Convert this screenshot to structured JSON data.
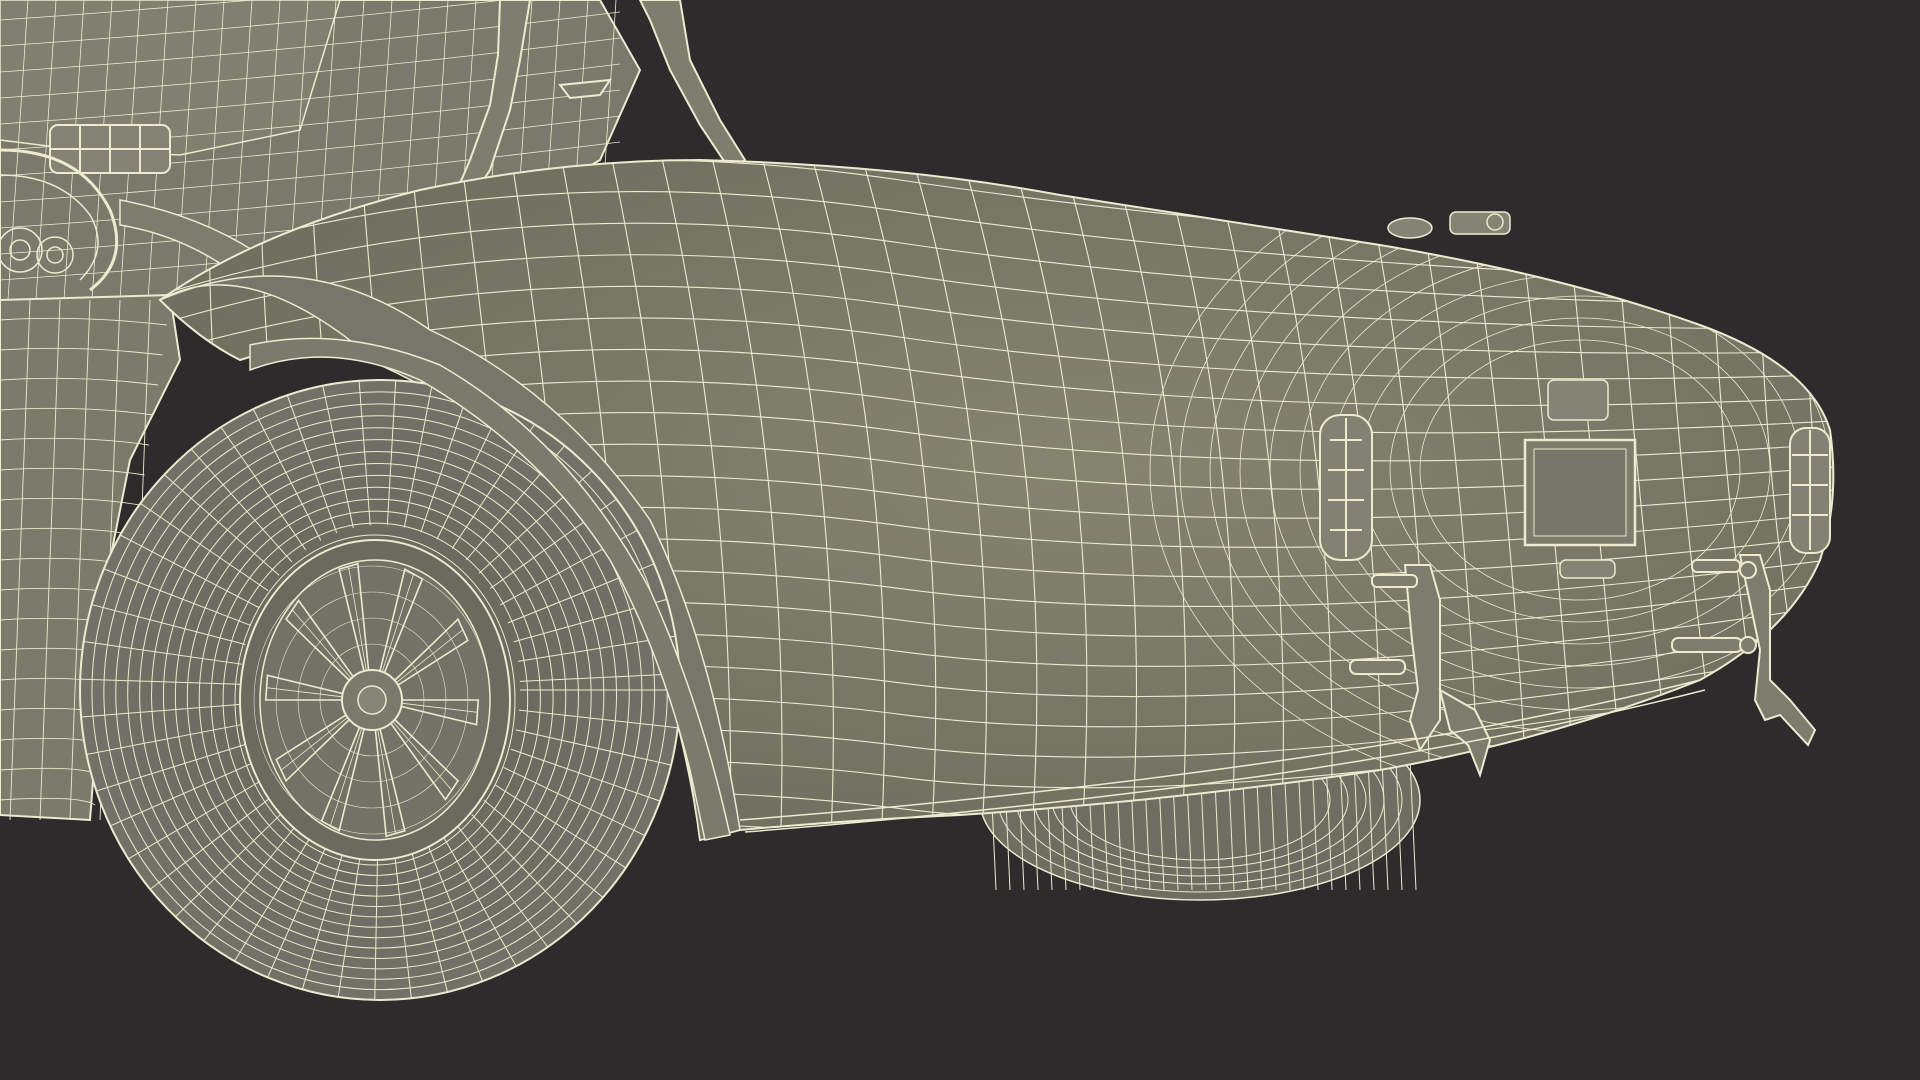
{
  "scene": {
    "subject": "wireframe-3d-render-rear-roadster",
    "view": "rear-three-quarter",
    "render_style": "clay-shaded-with-wireframe-overlay"
  },
  "colors": {
    "background": "#2d2b2b",
    "body": "#7c7b6b",
    "body_light": "#8a897a",
    "body_dark": "#5f5e52",
    "tire": "#6f6e62",
    "wire": "#ecebd0",
    "shadow": "#3a3935"
  }
}
